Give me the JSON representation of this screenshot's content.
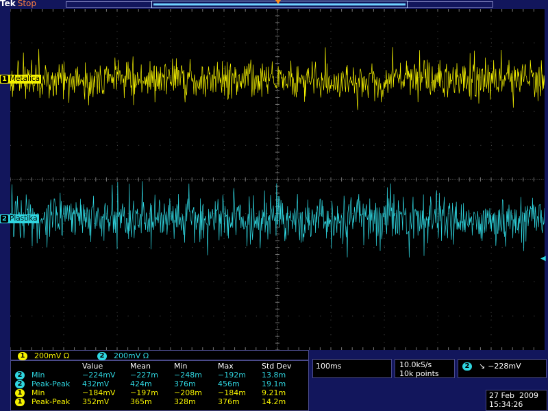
{
  "header": {
    "brand": "Tek",
    "run_state": "Stop"
  },
  "channels": [
    {
      "num": "1",
      "label": "Metalica",
      "color": "#f5f200"
    },
    {
      "num": "2",
      "label": "Plastika",
      "color": "#2fd6e0"
    }
  ],
  "scale": [
    {
      "num": "1",
      "value": "200mV Ω"
    },
    {
      "num": "2",
      "value": "200mV Ω"
    }
  ],
  "measurements": {
    "columns": [
      "Value",
      "Mean",
      "Min",
      "Max",
      "Std Dev"
    ],
    "rows": [
      {
        "ch": "2",
        "name": "Min",
        "value": "−224mV",
        "mean": "−227m",
        "min": "−248m",
        "max": "−192m",
        "std": "13.8m"
      },
      {
        "ch": "2",
        "name": "Peak-Peak",
        "value": "432mV",
        "mean": "424m",
        "min": "376m",
        "max": "456m",
        "std": "19.1m"
      },
      {
        "ch": "1",
        "name": "Min",
        "value": "−184mV",
        "mean": "−197m",
        "min": "−208m",
        "max": "−184m",
        "std": "9.21m"
      },
      {
        "ch": "1",
        "name": "Peak-Peak",
        "value": "352mV",
        "mean": "365m",
        "min": "328m",
        "max": "376m",
        "std": "14.2m"
      }
    ]
  },
  "timebase": "100ms",
  "sample_rate": "10.0kS/s",
  "record_length": "10k points",
  "trigger": {
    "source": "2",
    "slope": "↘",
    "level": "−228mV"
  },
  "date": "27 Feb  2009",
  "time": "15:34:26",
  "colors": {
    "grid": "#555555",
    "ch1": "#f5f200",
    "ch2": "#2fd6e0",
    "background": "#12165c"
  }
}
